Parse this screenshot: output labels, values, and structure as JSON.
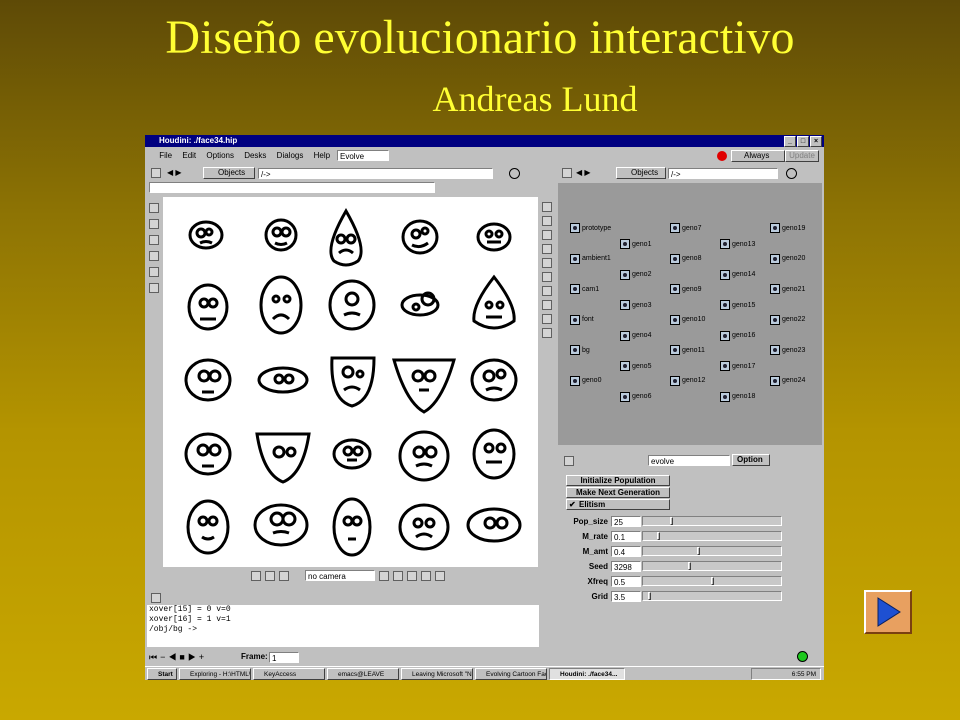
{
  "slide": {
    "title": "Diseño evolucionario interactivo",
    "author": "Andreas Lund"
  },
  "window": {
    "title": "Houdini: ./face34.hip",
    "min_label": "_",
    "max_label": "□",
    "close_label": "×"
  },
  "menu": {
    "items": [
      "File",
      "Edit",
      "Options",
      "Desks",
      "Dialogs",
      "Help"
    ],
    "desk_select": "Evolve",
    "update_mode": "Always",
    "update_button": "Update"
  },
  "viewer": {
    "path_label": "Objects",
    "path_field": "/->",
    "camera_select": "no camera"
  },
  "network": {
    "path_label": "Objects",
    "path_field": "/->",
    "nodes": [
      {
        "label": "prototype"
      },
      {
        "label": "ambient1"
      },
      {
        "label": "cam1"
      },
      {
        "label": "font"
      },
      {
        "label": "bg"
      },
      {
        "label": "geno0"
      },
      {
        "label": "geno1"
      },
      {
        "label": "geno2"
      },
      {
        "label": "geno3"
      },
      {
        "label": "geno4"
      },
      {
        "label": "geno5"
      },
      {
        "label": "geno6"
      },
      {
        "label": "geno7"
      },
      {
        "label": "geno8"
      },
      {
        "label": "geno9"
      },
      {
        "label": "geno10"
      },
      {
        "label": "geno11"
      },
      {
        "label": "geno12"
      },
      {
        "label": "geno13"
      },
      {
        "label": "geno14"
      },
      {
        "label": "geno15"
      },
      {
        "label": "geno16"
      },
      {
        "label": "geno17"
      },
      {
        "label": "geno18"
      },
      {
        "label": "geno19"
      },
      {
        "label": "geno20"
      },
      {
        "label": "geno21"
      },
      {
        "label": "geno22"
      },
      {
        "label": "geno23"
      },
      {
        "label": "geno24"
      }
    ]
  },
  "parameters": {
    "node_name": "evolve",
    "option_label": "Option",
    "init_button": "Initialize Population",
    "next_button": "Make Next Generation",
    "elitism_label": "Elitism",
    "elitism_checked": true,
    "rows": [
      {
        "label": "Pop_size",
        "value": "25",
        "fraction": 0.2
      },
      {
        "label": "M_rate",
        "value": "0.1",
        "fraction": 0.1
      },
      {
        "label": "M_amt",
        "value": "0.4",
        "fraction": 0.4
      },
      {
        "label": "Seed",
        "value": "3298",
        "fraction": 0.33
      },
      {
        "label": "Xfreq",
        "value": "0.5",
        "fraction": 0.5
      },
      {
        "label": "Grid",
        "value": "3.5",
        "fraction": 0.04
      }
    ]
  },
  "console": {
    "lines": [
      "xover[15] = 0  v=0",
      "xover[16] = 1  v=1",
      "/obj/bg ->"
    ]
  },
  "timeline": {
    "frame_label": "Frame:",
    "frame_value": "1"
  },
  "taskbar": {
    "start": "Start",
    "tasks": [
      "Exploring - H:\\HTML\\...",
      "KeyAccess",
      "emacs@LEAVE",
      "Leaving Microsoft \"N...",
      "Evolving Cartoon Fac...",
      "Houdini: ./face34..."
    ],
    "clock": "6:55 PM"
  },
  "colors": {
    "title_yellow": "#ffff33",
    "window_titlebar": "#000080",
    "nav_button": "#e8a060"
  }
}
